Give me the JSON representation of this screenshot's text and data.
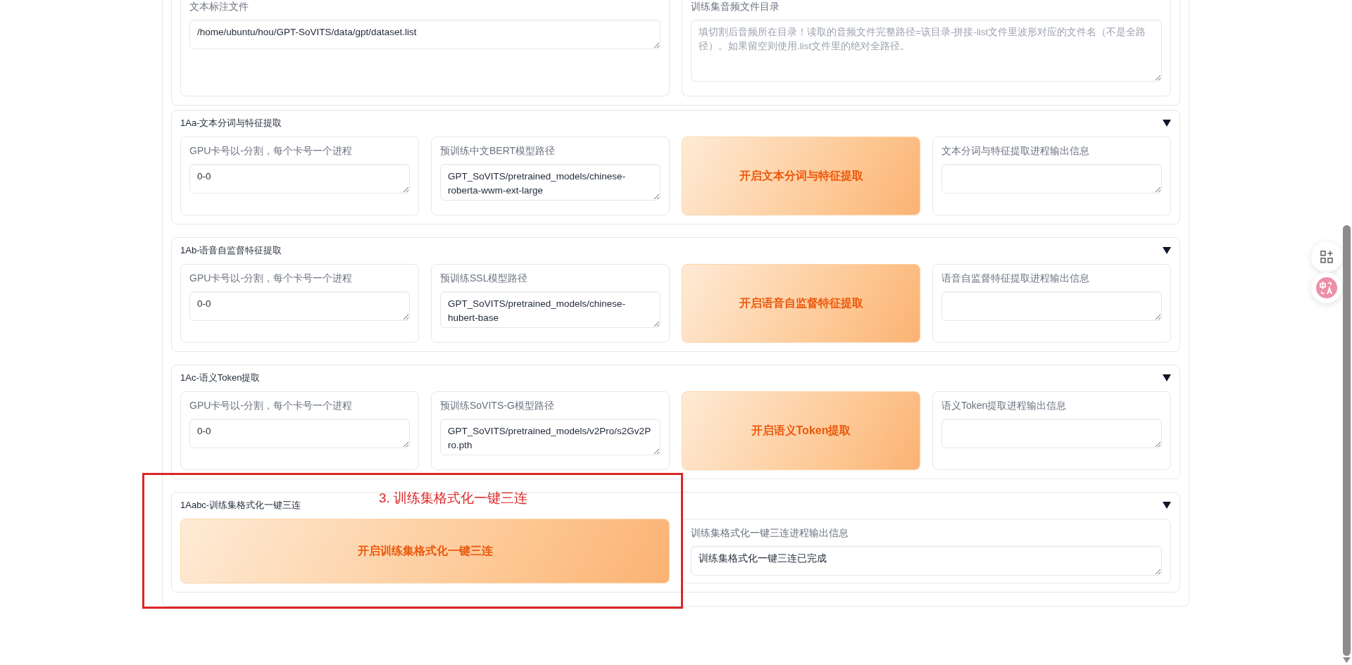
{
  "top_fields": [
    {
      "label": "文本标注文件",
      "value": "/home/ubuntu/hou/GPT-SoVITS/data/gpt/dataset.list"
    },
    {
      "label": "训练集音频文件目录",
      "placeholder": "填切割后音频所在目录！读取的音频文件完整路径=该目录-拼接-list文件里波形对应的文件名（不是全路径）。如果留空则使用.list文件里的绝对全路径。"
    }
  ],
  "sections": [
    {
      "title": "1Aa-文本分词与特征提取",
      "expanded": true,
      "items": [
        {
          "kind": "field",
          "label": "GPU卡号以-分割，每个卡号一个进程",
          "value": "0-0"
        },
        {
          "kind": "field",
          "label": "预训练中文BERT模型路径",
          "value": "GPT_SoVITS/pretrained_models/chinese-roberta-wwm-ext-large"
        },
        {
          "kind": "button",
          "label": "开启文本分词与特征提取"
        },
        {
          "kind": "field",
          "label": "文本分词与特征提取进程输出信息"
        }
      ]
    },
    {
      "title": "1Ab-语音自监督特征提取",
      "expanded": true,
      "items": [
        {
          "kind": "field",
          "label": "GPU卡号以-分割，每个卡号一个进程",
          "value": "0-0"
        },
        {
          "kind": "field",
          "label": "预训练SSL模型路径",
          "value": "GPT_SoVITS/pretrained_models/chinese-hubert-base"
        },
        {
          "kind": "button",
          "label": "开启语音自监督特征提取"
        },
        {
          "kind": "field",
          "label": "语音自监督特征提取进程输出信息"
        }
      ]
    },
    {
      "title": "1Ac-语义Token提取",
      "expanded": true,
      "items": [
        {
          "kind": "field",
          "label": "GPU卡号以-分割，每个卡号一个进程",
          "value": "0-0"
        },
        {
          "kind": "field",
          "label": "预训练SoVITS-G模型路径",
          "value": "GPT_SoVITS/pretrained_models/v2Pro/s2Gv2Pro.pth"
        },
        {
          "kind": "button",
          "label": "开启语义Token提取"
        },
        {
          "kind": "field",
          "label": "语义Token提取进程输出信息"
        }
      ]
    },
    {
      "title": "1Aabc-训练集格式化一键三连",
      "expanded": true,
      "items": [
        {
          "kind": "button",
          "label": "开启训练集格式化一键三连"
        },
        {
          "kind": "field",
          "label": "训练集格式化一键三连进程输出信息",
          "value": "训练集格式化一键三连已完成"
        }
      ]
    }
  ],
  "annotation": {
    "text": "3. 训练集格式化一键三连"
  }
}
